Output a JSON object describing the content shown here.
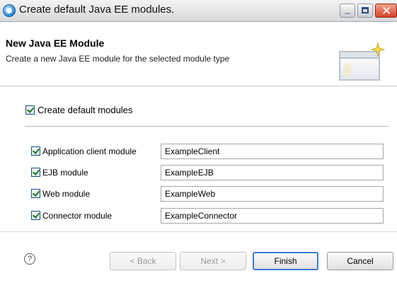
{
  "window": {
    "title": "Create default Java EE modules."
  },
  "header": {
    "title": "New Java EE Module",
    "description": "Create a new Java EE module for the selected module type"
  },
  "options": {
    "default_modules_label": "Create default modules",
    "default_modules_checked": true
  },
  "modules": [
    {
      "label": "Application client module",
      "checked": true,
      "value": "ExampleClient"
    },
    {
      "label": "EJB module",
      "checked": true,
      "value": "ExampleEJB"
    },
    {
      "label": "Web module",
      "checked": true,
      "value": "ExampleWeb"
    },
    {
      "label": "Connector module",
      "checked": true,
      "value": "ExampleConnector"
    }
  ],
  "buttons": {
    "help": "?",
    "back": "< Back",
    "next": "Next >",
    "finish": "Finish",
    "cancel": "Cancel"
  }
}
